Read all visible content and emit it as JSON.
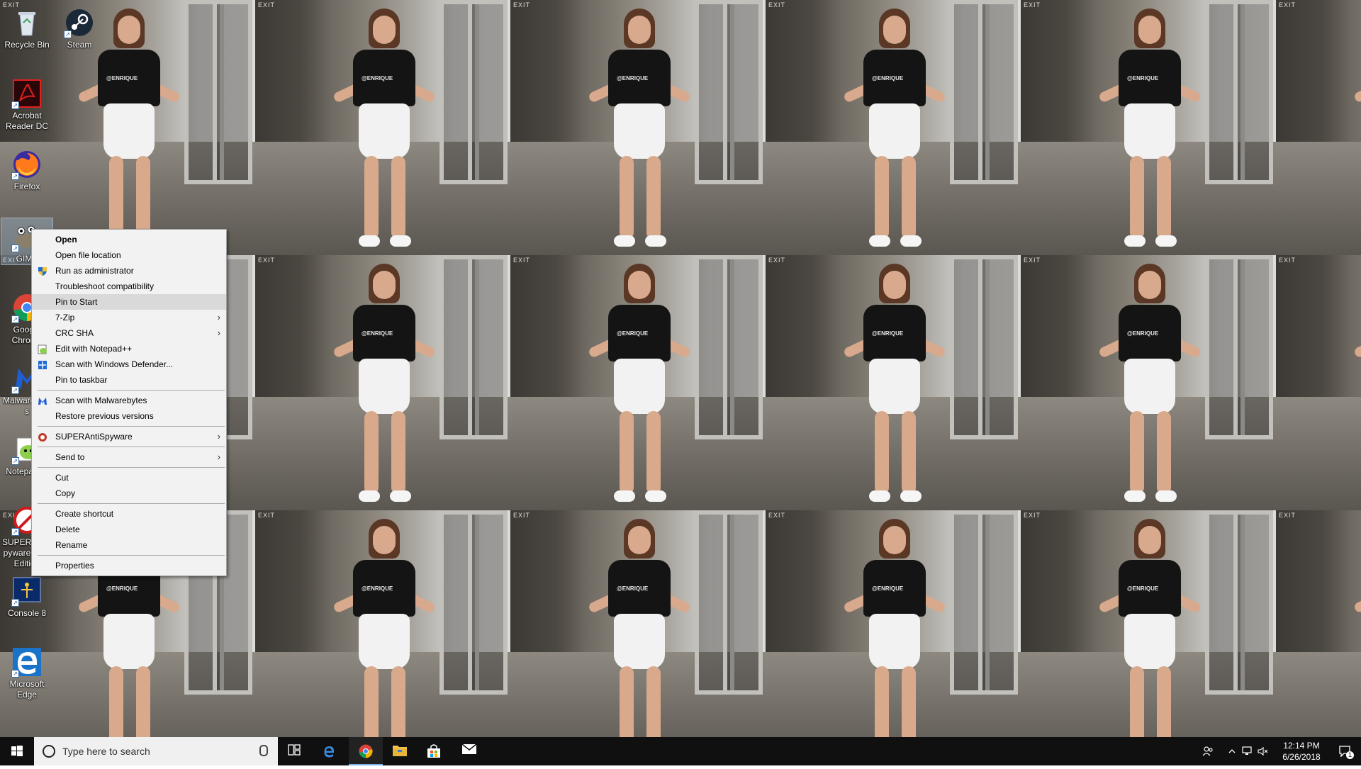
{
  "desktop_icons": [
    {
      "label": "Recycle Bin",
      "icon": "recycle-bin-icon"
    },
    {
      "label": "Steam",
      "icon": "steam-icon"
    },
    {
      "label": "Acrobat Reader DC",
      "icon": "acrobat-icon"
    },
    {
      "label": "Firefox",
      "icon": "firefox-icon"
    },
    {
      "label": "GIMP",
      "icon": "gimp-icon"
    },
    {
      "label": "Google Chrome",
      "icon": "chrome-icon"
    },
    {
      "label": "Malwarebytes",
      "icon": "malwarebytes-icon"
    },
    {
      "label": "Notepad++",
      "icon": "notepadpp-icon"
    },
    {
      "label": "SUPERAntiSpyware Free Edition",
      "icon": "superantispyware-icon"
    },
    {
      "label": "Console 8",
      "icon": "console-icon"
    },
    {
      "label": "Microsoft Edge",
      "icon": "edge-icon"
    }
  ],
  "context_menu": {
    "items": [
      {
        "label": "Open",
        "bold": true
      },
      {
        "label": "Open file location"
      },
      {
        "label": "Run as administrator",
        "icon": "shield-icon"
      },
      {
        "label": "Troubleshoot compatibility"
      },
      {
        "label": "Pin to Start",
        "highlighted": true
      },
      {
        "label": "7-Zip",
        "submenu": true
      },
      {
        "label": "CRC SHA",
        "submenu": true
      },
      {
        "label": "Edit with Notepad++",
        "icon": "notepadpp-icon"
      },
      {
        "label": "Scan with Windows Defender...",
        "icon": "defender-icon"
      },
      {
        "label": "Pin to taskbar"
      },
      {
        "separator": true
      },
      {
        "label": "Scan with Malwarebytes",
        "icon": "malwarebytes-icon"
      },
      {
        "label": "Restore previous versions"
      },
      {
        "separator": true
      },
      {
        "label": "SUPERAntiSpyware",
        "icon": "superantispyware-icon",
        "submenu": true
      },
      {
        "separator": true
      },
      {
        "label": "Send to",
        "submenu": true
      },
      {
        "separator": true
      },
      {
        "label": "Cut"
      },
      {
        "label": "Copy"
      },
      {
        "separator": true
      },
      {
        "label": "Create shortcut"
      },
      {
        "label": "Delete"
      },
      {
        "label": "Rename"
      },
      {
        "separator": true
      },
      {
        "label": "Properties"
      }
    ]
  },
  "wallpaper": {
    "sign_text": "EXIT",
    "shirt_text": "@ENRIQUE"
  },
  "taskbar": {
    "search_placeholder": "Type here to search",
    "apps": [
      {
        "name": "task-view",
        "icon": "task-view-icon"
      },
      {
        "name": "edge",
        "icon": "edge-icon"
      },
      {
        "name": "chrome",
        "icon": "chrome-icon",
        "active": true
      },
      {
        "name": "file-explorer",
        "icon": "folder-icon"
      },
      {
        "name": "store",
        "icon": "store-icon"
      },
      {
        "name": "mail",
        "icon": "mail-icon"
      }
    ],
    "clock": {
      "time": "12:14 PM",
      "date": "6/26/2018"
    },
    "notification_count": "1"
  },
  "colors": {
    "accent": "#7fb2ea",
    "menu_bg": "#f2f2f2",
    "taskbar_bg": "#101010"
  }
}
